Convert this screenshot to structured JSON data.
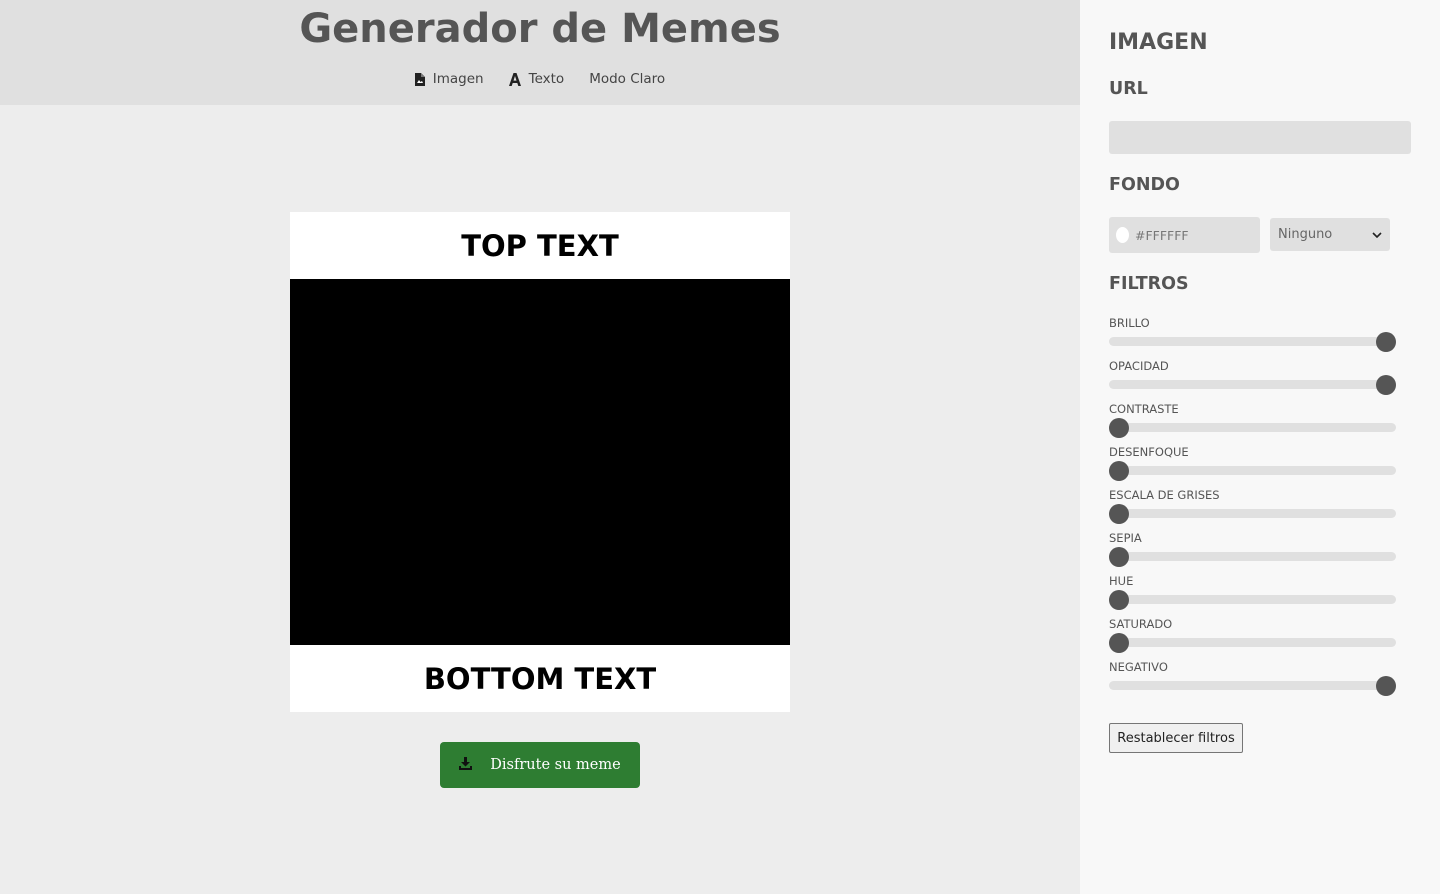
{
  "header": {
    "title": "Generador de Memes",
    "nav": [
      {
        "label": "Imagen",
        "icon": "image-file-icon"
      },
      {
        "label": "Texto",
        "icon": "font-icon"
      },
      {
        "label": "Modo Claro",
        "icon": ""
      }
    ]
  },
  "meme": {
    "top_text": "TOP TEXT",
    "bottom_text": "BOTTOM TEXT",
    "download_label": "Disfrute su meme"
  },
  "panel": {
    "title": "IMAGEN",
    "url_label": "URL",
    "url_value": "",
    "background_label": "FONDO",
    "background_color": "#FFFFFF",
    "blend_mode": "Ninguno",
    "filters_label": "FILTROS",
    "filters": [
      {
        "label": "BRILLO",
        "value": 1
      },
      {
        "label": "OPACIDAD",
        "value": 1
      },
      {
        "label": "CONTRASTE",
        "value": 0
      },
      {
        "label": "DESENFOQUE",
        "value": 0
      },
      {
        "label": "ESCALA DE GRISES",
        "value": 0
      },
      {
        "label": "SEPIA",
        "value": 0
      },
      {
        "label": "HUE",
        "value": 0
      },
      {
        "label": "SATURADO",
        "value": 0
      },
      {
        "label": "NEGATIVO",
        "value": 1
      }
    ],
    "reset_label": "Restablecer filtros"
  },
  "colors": {
    "download_button": "#2e7d32",
    "slider_thumb": "#555555",
    "slider_track": "#e0e0e0"
  }
}
